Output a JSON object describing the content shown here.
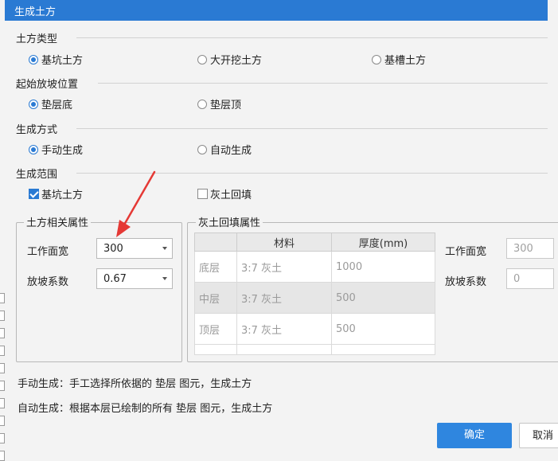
{
  "dialog": {
    "title": "生成土方"
  },
  "sections": {
    "earthwork_type": {
      "label": "土方类型",
      "options": [
        "基坑土方",
        "大开挖土方",
        "基槽土方"
      ],
      "selected": "基坑土方"
    },
    "start_slope_position": {
      "label": "起始放坡位置",
      "options": [
        "垫层底",
        "垫层顶"
      ],
      "selected": "垫层底"
    },
    "generation_method": {
      "label": "生成方式",
      "options": [
        "手动生成",
        "自动生成"
      ],
      "selected": "手动生成"
    },
    "generation_scope": {
      "label": "生成范围",
      "options": [
        {
          "label": "基坑土方",
          "checked": true
        },
        {
          "label": "灰土回填",
          "checked": false
        }
      ]
    }
  },
  "earthwork_props": {
    "label": "土方相关属性",
    "work_width_label": "工作面宽",
    "work_width_value": "300",
    "slope_coef_label": "放坡系数",
    "slope_coef_value": "0.67"
  },
  "lime_fill_props": {
    "label": "灰土回填属性",
    "columns": [
      "",
      "材料",
      "厚度(mm)"
    ],
    "rows": [
      [
        "底层",
        "3:7 灰土",
        "1000"
      ],
      [
        "中层",
        "3:7 灰土",
        "500"
      ],
      [
        "顶层",
        "3:7 灰土",
        "500"
      ]
    ],
    "work_width_label": "工作面宽",
    "work_width_value": "300",
    "slope_coef_label": "放坡系数",
    "slope_coef_value": "0"
  },
  "descriptions": {
    "manual": "手动生成：手工选择所依据的 垫层 图元，生成土方",
    "auto": "自动生成：根据本层已绘制的所有 垫层 图元，生成土方"
  },
  "buttons": {
    "ok": "确定",
    "cancel": "取消"
  },
  "colors": {
    "accent": "#2a7ad3",
    "annotation_arrow": "#e53935"
  }
}
